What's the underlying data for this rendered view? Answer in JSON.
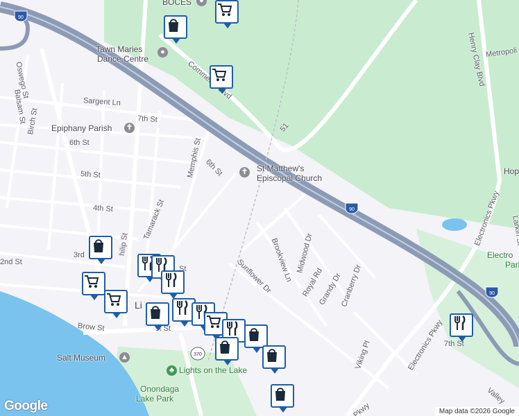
{
  "map": {
    "attribution": "Map data ©2026 Google",
    "logo": "Google",
    "colors": {
      "background": "#f4f3f7",
      "park": "#c9ecd0",
      "water": "#79c3ee",
      "highway": "#8c9bb5",
      "road": "#ffffff",
      "pin": "#1d5ea8"
    }
  },
  "street_labels": {
    "oswego_st": "Oswego St",
    "balsam_st": "Balsam St",
    "birch_st": "Birch St",
    "sargent_ln": "Sargent Ln",
    "seventh_st": "7th St",
    "sixth_st_w": "6th St",
    "sixth_st_e": "6th St",
    "fifth_st": "5th St",
    "fourth_st": "4th St",
    "third_st": "3rd",
    "second_st": "2nd St",
    "first_st": "st St",
    "brow_st": "Brow St",
    "memphis_st": "Memphis St",
    "tamarack_st": "Tamarack St",
    "phillip_st": "hilip St",
    "commerce_blvd": "Commerce Blvd",
    "route_51": "51",
    "sunflower_dr": "Sunflower Dr",
    "brookview_ln": "Brookview Ln",
    "midwood_dr": "Midwood Dr",
    "royal_rd": "Royal Rd",
    "grandy_dr": "Grandy Dr",
    "cranberry_dr": "Cranberry Dr",
    "viking_pl": "Viking Pl",
    "electronics_pkwy_n": "Electronics Pkwy",
    "electronics_pkwy_s": "Electronics Pkwy",
    "henry_clay_blvd": "Henry Clay Blvd",
    "larkin_st": "Larkin St",
    "metropolitan": "Metropoli",
    "pkwy": "Pkwy",
    "valley": "Valley",
    "seventh_north": "7th St",
    "st_lbl": "St"
  },
  "places": {
    "boces": "BOCES",
    "tawn_maries": [
      "Tawn Maries",
      "Dance Centre"
    ],
    "epiphany": "Epiphany Parish",
    "st_matthews": [
      "St Matthew's",
      "Episcopal Church"
    ],
    "salt_museum": "Salt Museum",
    "lights_on_lake": "Lights on the Lake",
    "onondaga": [
      "Onondaga",
      "Lake Park"
    ],
    "electronics_park": [
      "Electro",
      "Park"
    ],
    "hop": "Hop",
    "li": "Li"
  },
  "shields": {
    "i90_a": "90",
    "i90_b": "90",
    "i90_c": "90",
    "i90_d": "90",
    "route_370": "370"
  },
  "pins": [
    {
      "icon": "cart-icon"
    },
    {
      "icon": "shopping-bag-icon"
    },
    {
      "icon": "cart-icon"
    },
    {
      "icon": "shopping-bag-icon"
    },
    {
      "icon": "restaurant-icon"
    },
    {
      "icon": "restaurant-icon"
    },
    {
      "icon": "restaurant-icon"
    },
    {
      "icon": "cart-icon"
    },
    {
      "icon": "cart-icon"
    },
    {
      "icon": "shopping-bag-icon"
    },
    {
      "icon": "restaurant-icon"
    },
    {
      "icon": "restaurant-icon"
    },
    {
      "icon": "cart-icon"
    },
    {
      "icon": "restaurant-icon"
    },
    {
      "icon": "shopping-bag-icon"
    },
    {
      "icon": "shopping-bag-icon"
    },
    {
      "icon": "shopping-bag-icon"
    },
    {
      "icon": "shopping-bag-icon"
    },
    {
      "icon": "restaurant-icon"
    }
  ]
}
